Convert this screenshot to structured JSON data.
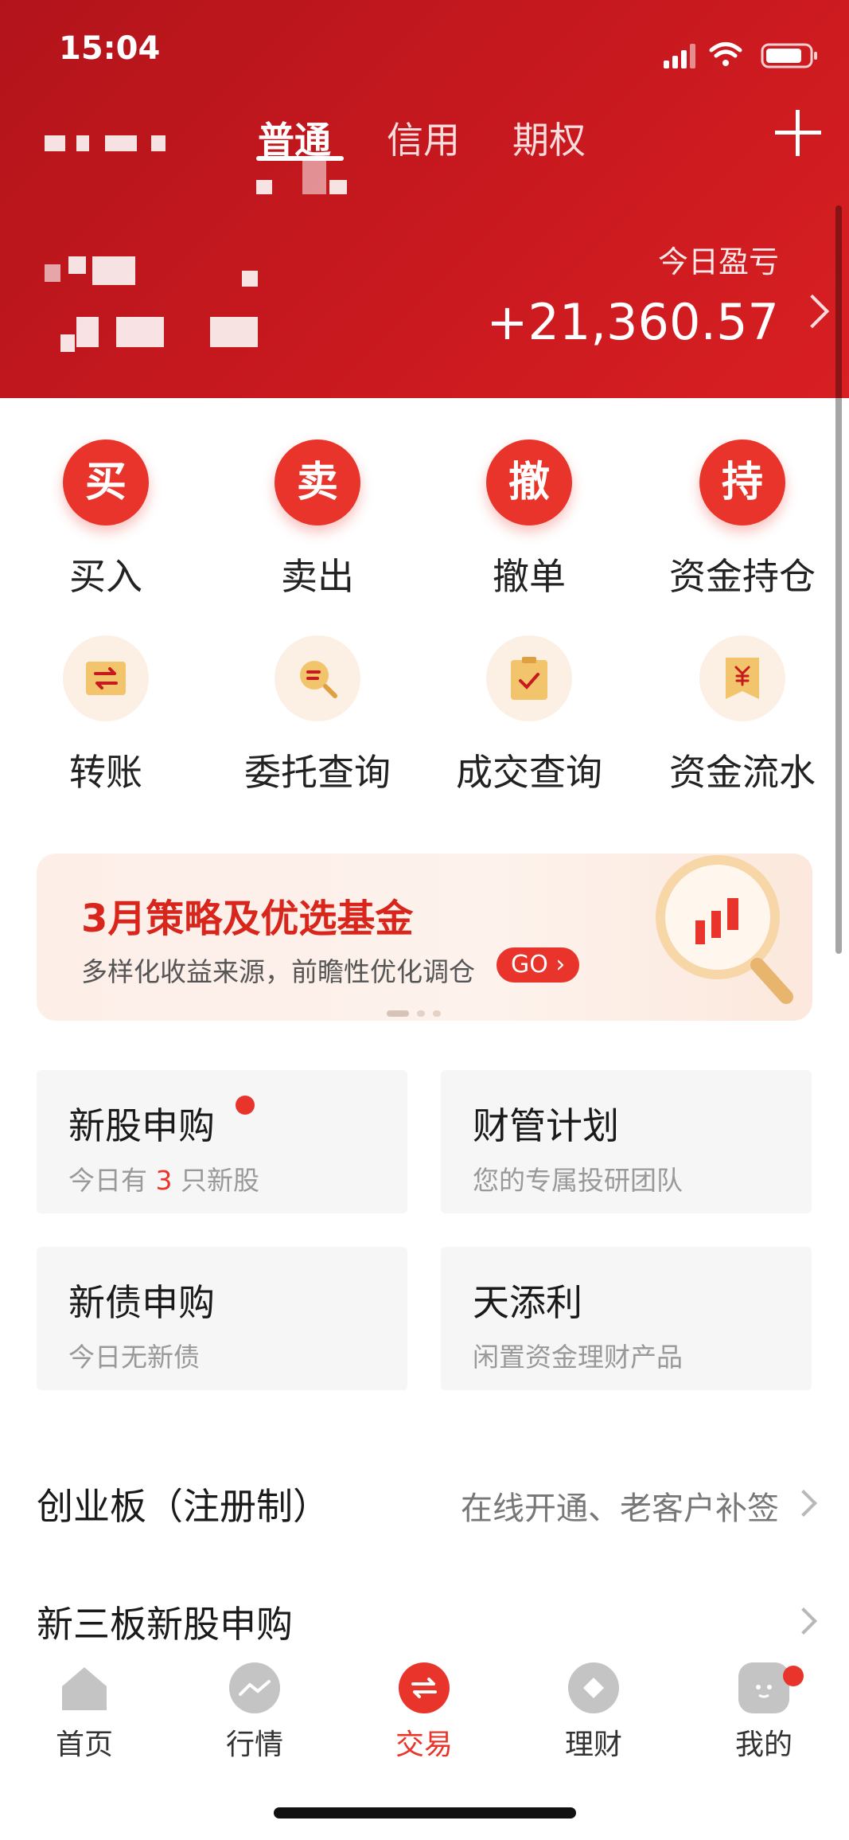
{
  "status_bar": {
    "time": "15:04"
  },
  "header": {
    "tabs": [
      {
        "label": "普通",
        "active": true
      },
      {
        "label": "信用",
        "active": false
      },
      {
        "label": "期权",
        "active": false
      }
    ],
    "pnl_label": "今日盈亏",
    "pnl_value": "+21,360.57"
  },
  "actions_primary": [
    {
      "glyph": "买",
      "label": "买入"
    },
    {
      "glyph": "卖",
      "label": "卖出"
    },
    {
      "glyph": "撤",
      "label": "撤单"
    },
    {
      "glyph": "持",
      "label": "资金持仓"
    }
  ],
  "actions_secondary": [
    {
      "icon": "transfer-icon",
      "label": "转账"
    },
    {
      "icon": "search-order-icon",
      "label": "委托查询"
    },
    {
      "icon": "clipboard-check-icon",
      "label": "成交查询"
    },
    {
      "icon": "yuan-receipt-icon",
      "label": "资金流水"
    }
  ],
  "banner": {
    "title": "3月策略及优选基金",
    "subtitle": "多样化收益来源，前瞻性优化调仓",
    "go_label": "GO"
  },
  "services": [
    {
      "title": "新股申购",
      "sub_prefix": "今日有 ",
      "sub_highlight": "3",
      "sub_suffix": " 只新股",
      "badge": true
    },
    {
      "title": "财管计划",
      "subtitle": "您的专属投研团队"
    },
    {
      "title": "新债申购",
      "subtitle": "今日无新债"
    },
    {
      "title": "天添利",
      "subtitle": "闲置资金理财产品"
    }
  ],
  "rows": [
    {
      "title": "创业板（注册制）",
      "value": "在线开通、老客户补签"
    },
    {
      "title": "新三板新股申购",
      "value": ""
    }
  ],
  "tabbar": [
    {
      "label": "首页",
      "icon": "home-icon",
      "active": false
    },
    {
      "label": "行情",
      "icon": "chart-icon",
      "active": false
    },
    {
      "label": "交易",
      "icon": "trade-icon",
      "active": true
    },
    {
      "label": "理财",
      "icon": "diamond-icon",
      "active": false
    },
    {
      "label": "我的",
      "icon": "profile-icon",
      "active": false,
      "badge": true
    }
  ],
  "colors": {
    "brand_red": "#c8191f",
    "accent": "#e8342a"
  }
}
